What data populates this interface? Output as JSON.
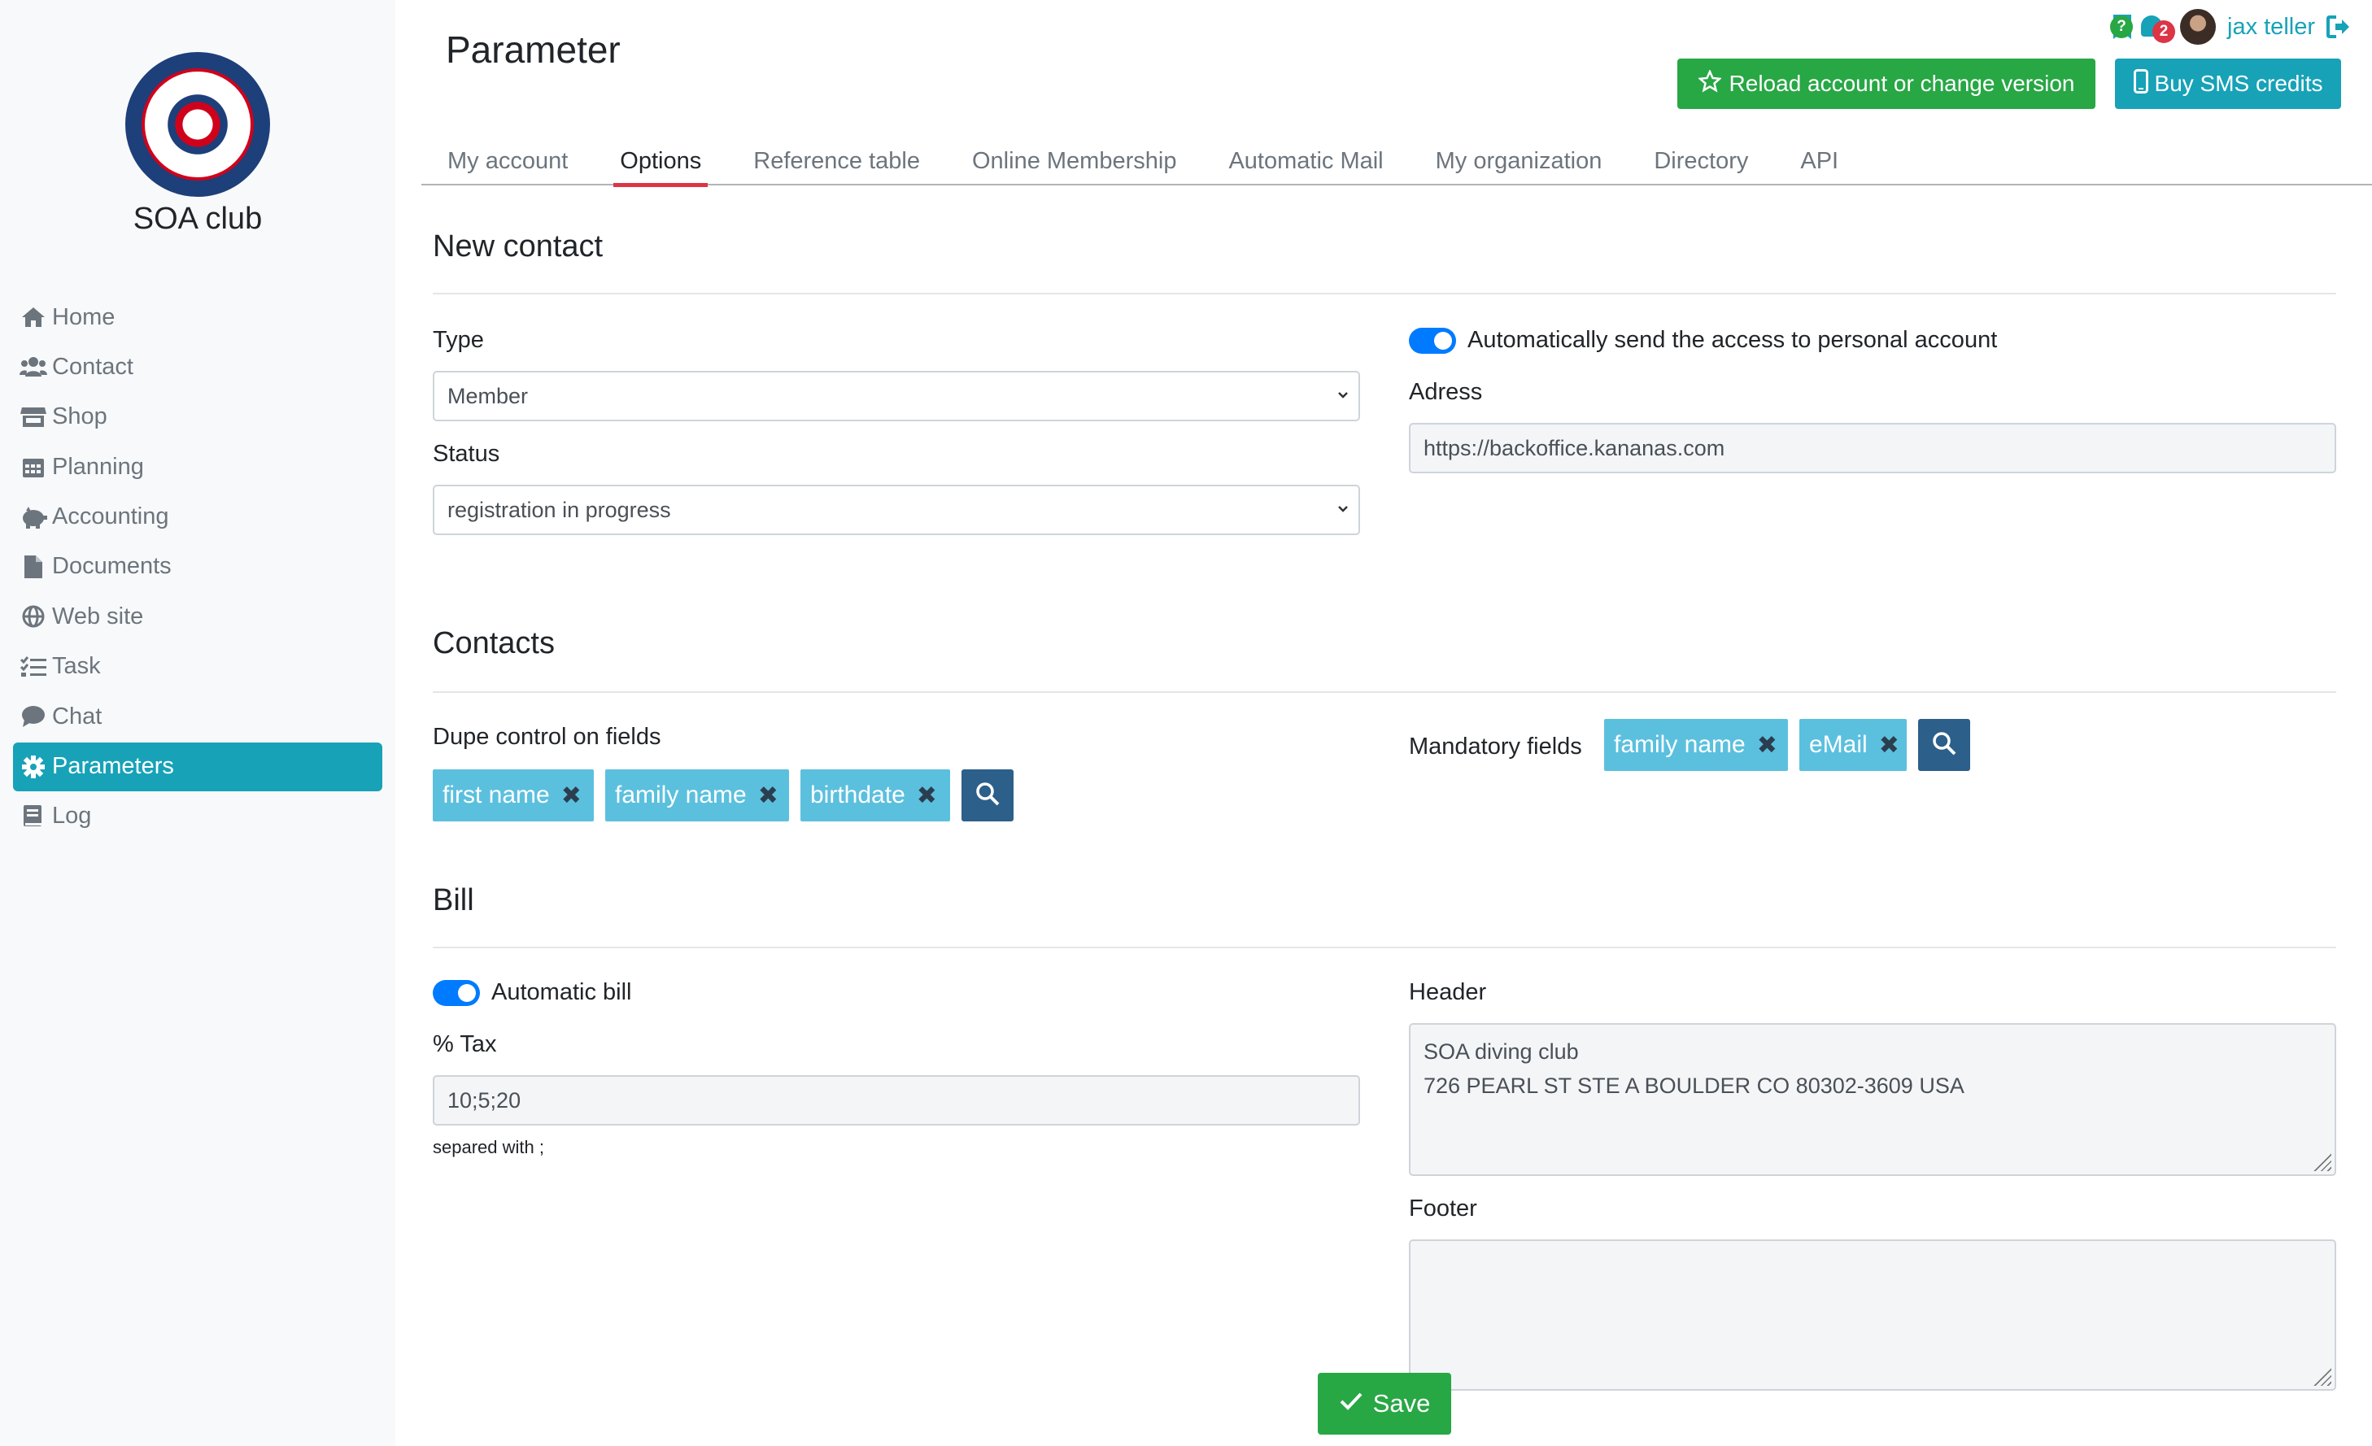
{
  "sidebar": {
    "club_name": "SOA club",
    "items": [
      {
        "label": "Home",
        "icon": "home-icon"
      },
      {
        "label": "Contact",
        "icon": "users-icon"
      },
      {
        "label": "Shop",
        "icon": "store-icon"
      },
      {
        "label": "Planning",
        "icon": "calendar-icon"
      },
      {
        "label": "Accounting",
        "icon": "piggy-bank-icon"
      },
      {
        "label": "Documents",
        "icon": "file-icon"
      },
      {
        "label": "Web site",
        "icon": "globe-icon"
      },
      {
        "label": "Task",
        "icon": "tasks-icon"
      },
      {
        "label": "Chat",
        "icon": "comment-icon"
      },
      {
        "label": "Parameters",
        "icon": "gear-icon",
        "active": true
      },
      {
        "label": "Log",
        "icon": "book-icon"
      }
    ]
  },
  "header": {
    "title": "Parameter",
    "notifications_count": "2",
    "help_label": "?",
    "user_name": "jax teller",
    "reload_label": "Reload account or change version",
    "sms_label": "Buy SMS credits"
  },
  "tabs": [
    {
      "label": "My account"
    },
    {
      "label": "Options",
      "active": true
    },
    {
      "label": "Reference table"
    },
    {
      "label": "Online Membership"
    },
    {
      "label": "Automatic Mail"
    },
    {
      "label": "My organization"
    },
    {
      "label": "Directory"
    },
    {
      "label": "API"
    }
  ],
  "new_contact": {
    "title": "New contact",
    "type_label": "Type",
    "type_value": "Member",
    "status_label": "Status",
    "status_value": "registration in progress",
    "auto_send_label": "Automatically send the access to personal account",
    "address_label": "Adress",
    "address_value": "https://backoffice.kananas.com"
  },
  "contacts": {
    "title": "Contacts",
    "dupe_label": "Dupe control on fields",
    "dupe_tags": [
      "first name",
      "family name",
      "birthdate"
    ],
    "mandatory_label": "Mandatory fields",
    "mandatory_tags": [
      "family name",
      "eMail"
    ]
  },
  "bill": {
    "title": "Bill",
    "auto_bill_label": "Automatic bill",
    "tax_label": "% Tax",
    "tax_value": "10;5;20",
    "tax_help": "separed with ;",
    "header_label": "Header",
    "header_line1": "SOA diving club",
    "header_line2": "726 PEARL ST STE A BOULDER CO 80302-3609 USA",
    "footer_label": "Footer",
    "footer_value": ""
  },
  "save_label": "Save",
  "colors": {
    "accent": "#17a2b8",
    "success": "#28a745",
    "danger": "#dc3545",
    "primary": "#007bff",
    "tag": "#5bc0de",
    "search_button": "#2c5f8a"
  }
}
